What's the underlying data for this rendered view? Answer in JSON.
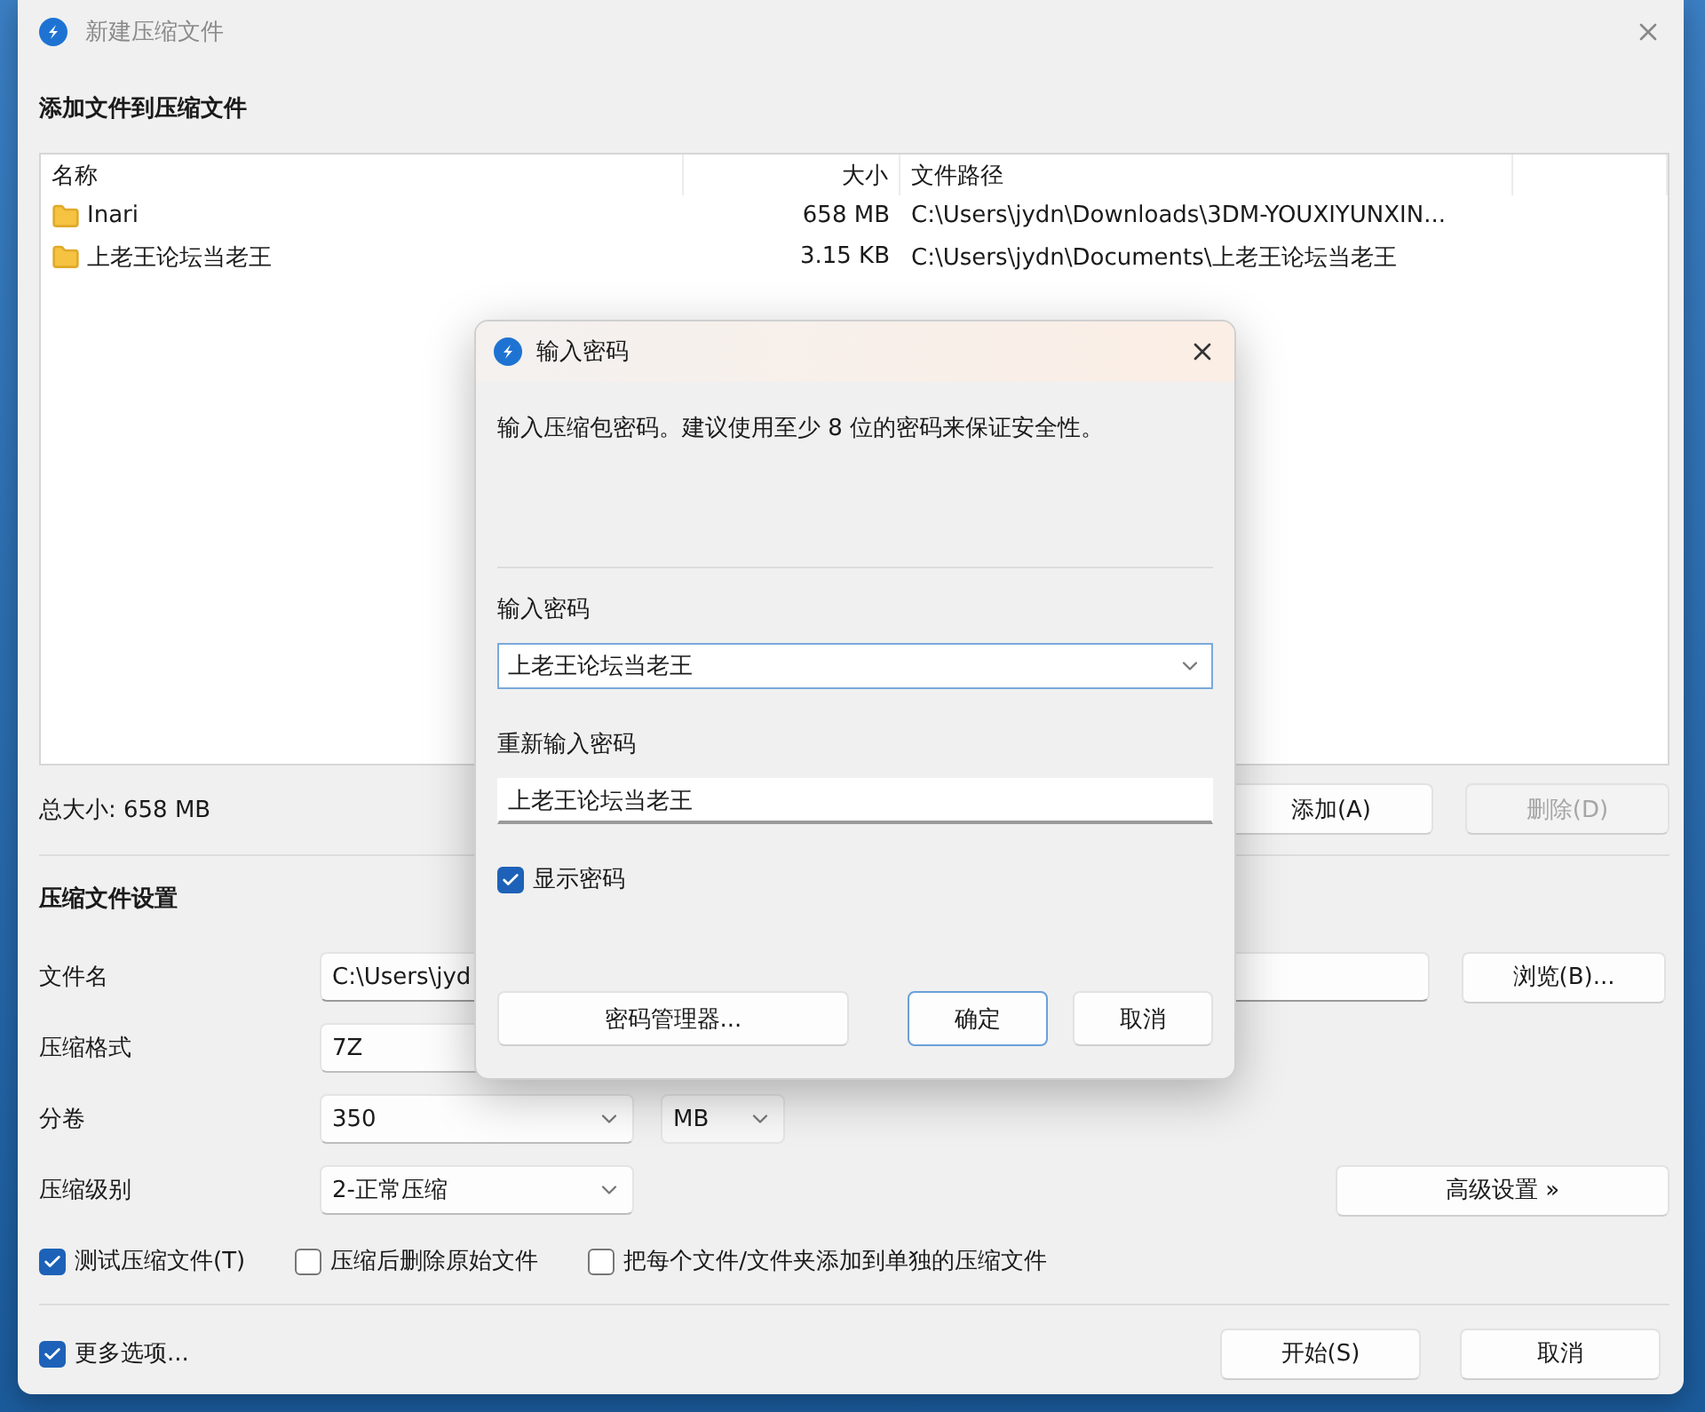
{
  "window": {
    "title": "新建压缩文件"
  },
  "files": {
    "heading": "添加文件到压缩文件",
    "columns": [
      "名称",
      "大小",
      "文件路径"
    ],
    "rows": [
      {
        "name": "Inari",
        "size": "658 MB",
        "path": "C:\\Users\\jydn\\Downloads\\3DM-YOUXIYUNXIN..."
      },
      {
        "name": "上老王论坛当老王",
        "size": "3.15 KB",
        "path": "C:\\Users\\jydn\\Documents\\上老王论坛当老王"
      }
    ]
  },
  "total_size": "总大小: 658 MB",
  "file_buttons": [
    {
      "label": "添加(A)",
      "disabled": false
    },
    {
      "label": "删除(D)",
      "disabled": true
    }
  ],
  "settings": {
    "heading": "压缩文件设置",
    "fields": [
      {
        "kind": "text",
        "label": "文件名",
        "value": "C:\\Users\\jyd",
        "button": "浏览(B)..."
      },
      {
        "kind": "field",
        "label": "压缩格式",
        "value": "7Z"
      },
      {
        "kind": "combo",
        "label": "分卷",
        "value": "350",
        "unit": "MB"
      },
      {
        "kind": "combo",
        "label": "压缩级别",
        "value": "2-正常压缩",
        "button": "高级设置 »"
      }
    ]
  },
  "options": [
    {
      "label": "测试压缩文件(T)",
      "checked": true
    },
    {
      "label": "压缩后删除原始文件",
      "checked": false
    },
    {
      "label": "把每个文件/文件夹添加到单独的压缩文件",
      "checked": false
    }
  ],
  "more_options": {
    "label": "更多选项...",
    "checked": true
  },
  "actions": [
    {
      "label": "开始(S)"
    },
    {
      "label": "取消"
    }
  ],
  "dialog": {
    "title": "输入密码",
    "message": "输入压缩包密码。建议使用至少 8 位的密码来保证安全性。",
    "password_label": "输入密码",
    "password": "上老王论坛当老王",
    "confirm_label": "重新输入密码",
    "confirm": "上老王论坛当老王",
    "show_password": {
      "label": "显示密码",
      "checked": true
    },
    "buttons": [
      {
        "label": "密码管理器...",
        "default": false
      },
      {
        "label": "确定",
        "default": true
      },
      {
        "label": "取消",
        "default": false
      }
    ]
  }
}
